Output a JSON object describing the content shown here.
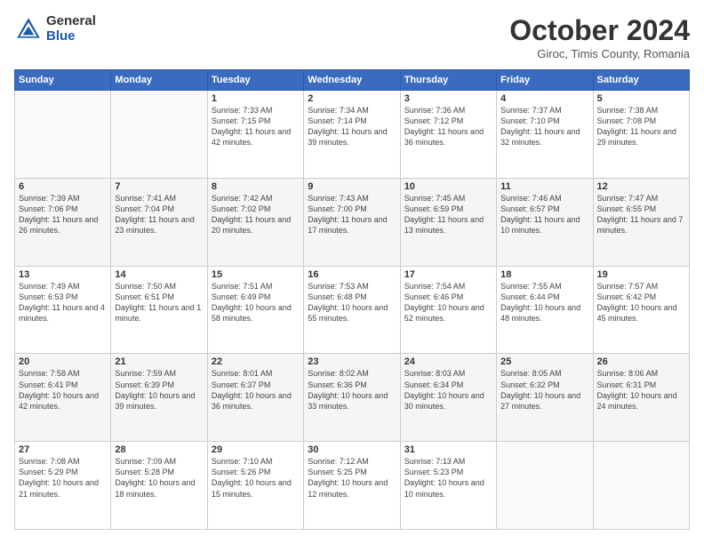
{
  "header": {
    "logo_general": "General",
    "logo_blue": "Blue",
    "month_title": "October 2024",
    "subtitle": "Giroc, Timis County, Romania"
  },
  "days_of_week": [
    "Sunday",
    "Monday",
    "Tuesday",
    "Wednesday",
    "Thursday",
    "Friday",
    "Saturday"
  ],
  "weeks": [
    [
      {
        "day": "",
        "info": ""
      },
      {
        "day": "",
        "info": ""
      },
      {
        "day": "1",
        "info": "Sunrise: 7:33 AM\nSunset: 7:15 PM\nDaylight: 11 hours and 42 minutes."
      },
      {
        "day": "2",
        "info": "Sunrise: 7:34 AM\nSunset: 7:14 PM\nDaylight: 11 hours and 39 minutes."
      },
      {
        "day": "3",
        "info": "Sunrise: 7:36 AM\nSunset: 7:12 PM\nDaylight: 11 hours and 36 minutes."
      },
      {
        "day": "4",
        "info": "Sunrise: 7:37 AM\nSunset: 7:10 PM\nDaylight: 11 hours and 32 minutes."
      },
      {
        "day": "5",
        "info": "Sunrise: 7:38 AM\nSunset: 7:08 PM\nDaylight: 11 hours and 29 minutes."
      }
    ],
    [
      {
        "day": "6",
        "info": "Sunrise: 7:39 AM\nSunset: 7:06 PM\nDaylight: 11 hours and 26 minutes."
      },
      {
        "day": "7",
        "info": "Sunrise: 7:41 AM\nSunset: 7:04 PM\nDaylight: 11 hours and 23 minutes."
      },
      {
        "day": "8",
        "info": "Sunrise: 7:42 AM\nSunset: 7:02 PM\nDaylight: 11 hours and 20 minutes."
      },
      {
        "day": "9",
        "info": "Sunrise: 7:43 AM\nSunset: 7:00 PM\nDaylight: 11 hours and 17 minutes."
      },
      {
        "day": "10",
        "info": "Sunrise: 7:45 AM\nSunset: 6:59 PM\nDaylight: 11 hours and 13 minutes."
      },
      {
        "day": "11",
        "info": "Sunrise: 7:46 AM\nSunset: 6:57 PM\nDaylight: 11 hours and 10 minutes."
      },
      {
        "day": "12",
        "info": "Sunrise: 7:47 AM\nSunset: 6:55 PM\nDaylight: 11 hours and 7 minutes."
      }
    ],
    [
      {
        "day": "13",
        "info": "Sunrise: 7:49 AM\nSunset: 6:53 PM\nDaylight: 11 hours and 4 minutes."
      },
      {
        "day": "14",
        "info": "Sunrise: 7:50 AM\nSunset: 6:51 PM\nDaylight: 11 hours and 1 minute."
      },
      {
        "day": "15",
        "info": "Sunrise: 7:51 AM\nSunset: 6:49 PM\nDaylight: 10 hours and 58 minutes."
      },
      {
        "day": "16",
        "info": "Sunrise: 7:53 AM\nSunset: 6:48 PM\nDaylight: 10 hours and 55 minutes."
      },
      {
        "day": "17",
        "info": "Sunrise: 7:54 AM\nSunset: 6:46 PM\nDaylight: 10 hours and 52 minutes."
      },
      {
        "day": "18",
        "info": "Sunrise: 7:55 AM\nSunset: 6:44 PM\nDaylight: 10 hours and 48 minutes."
      },
      {
        "day": "19",
        "info": "Sunrise: 7:57 AM\nSunset: 6:42 PM\nDaylight: 10 hours and 45 minutes."
      }
    ],
    [
      {
        "day": "20",
        "info": "Sunrise: 7:58 AM\nSunset: 6:41 PM\nDaylight: 10 hours and 42 minutes."
      },
      {
        "day": "21",
        "info": "Sunrise: 7:59 AM\nSunset: 6:39 PM\nDaylight: 10 hours and 39 minutes."
      },
      {
        "day": "22",
        "info": "Sunrise: 8:01 AM\nSunset: 6:37 PM\nDaylight: 10 hours and 36 minutes."
      },
      {
        "day": "23",
        "info": "Sunrise: 8:02 AM\nSunset: 6:36 PM\nDaylight: 10 hours and 33 minutes."
      },
      {
        "day": "24",
        "info": "Sunrise: 8:03 AM\nSunset: 6:34 PM\nDaylight: 10 hours and 30 minutes."
      },
      {
        "day": "25",
        "info": "Sunrise: 8:05 AM\nSunset: 6:32 PM\nDaylight: 10 hours and 27 minutes."
      },
      {
        "day": "26",
        "info": "Sunrise: 8:06 AM\nSunset: 6:31 PM\nDaylight: 10 hours and 24 minutes."
      }
    ],
    [
      {
        "day": "27",
        "info": "Sunrise: 7:08 AM\nSunset: 5:29 PM\nDaylight: 10 hours and 21 minutes."
      },
      {
        "day": "28",
        "info": "Sunrise: 7:09 AM\nSunset: 5:28 PM\nDaylight: 10 hours and 18 minutes."
      },
      {
        "day": "29",
        "info": "Sunrise: 7:10 AM\nSunset: 5:26 PM\nDaylight: 10 hours and 15 minutes."
      },
      {
        "day": "30",
        "info": "Sunrise: 7:12 AM\nSunset: 5:25 PM\nDaylight: 10 hours and 12 minutes."
      },
      {
        "day": "31",
        "info": "Sunrise: 7:13 AM\nSunset: 5:23 PM\nDaylight: 10 hours and 10 minutes."
      },
      {
        "day": "",
        "info": ""
      },
      {
        "day": "",
        "info": ""
      }
    ]
  ]
}
